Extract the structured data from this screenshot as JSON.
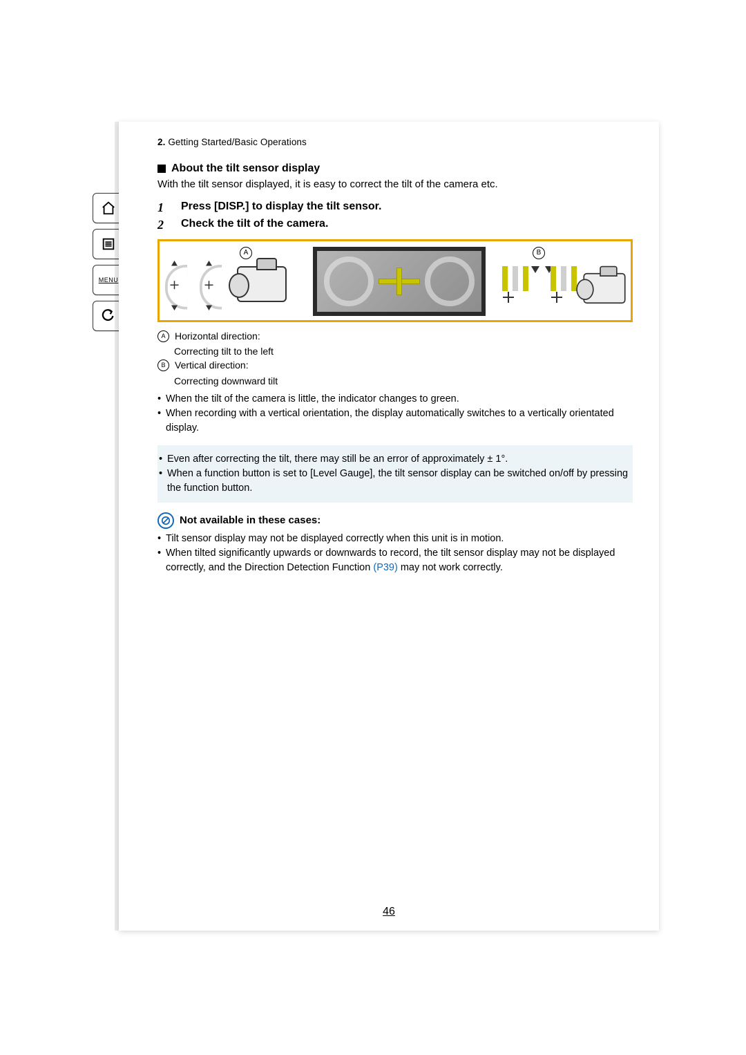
{
  "sidebar": {
    "home": "home-icon",
    "toc": "toc-icon",
    "menu_label": "MENU",
    "back": "back-icon"
  },
  "breadcrumb": {
    "number": "2.",
    "title": "Getting Started/Basic Operations"
  },
  "section": {
    "heading": "About the tilt sensor display",
    "intro": "With the tilt sensor displayed, it is easy to correct the tilt of the camera etc."
  },
  "steps": [
    {
      "n": "1",
      "text": "Press [DISP.] to display the tilt sensor."
    },
    {
      "n": "2",
      "text": "Check the tilt of the camera."
    }
  ],
  "diagram": {
    "label_A": "A",
    "label_B": "B"
  },
  "legend": {
    "A_label": "A",
    "A_title": "Horizontal direction:",
    "A_detail": "Correcting tilt to the left",
    "B_label": "B",
    "B_title": "Vertical direction:",
    "B_detail": "Correcting downward tilt"
  },
  "bullets_main": [
    "When the tilt of the camera is little, the indicator changes to green.",
    "When recording with a vertical orientation, the display automatically switches to a vertically orientated display."
  ],
  "note_bullets": [
    "Even after correcting the tilt, there may still be an error of approximately ± 1°.",
    "When a function button is set to [Level Gauge], the tilt sensor display can be switched on/off by pressing the function button."
  ],
  "not_available": {
    "heading": "Not available in these cases:",
    "bullets_before_ref": "Tilt sensor display may not be displayed correctly when this unit is in motion.",
    "bullet2_a": "When tilted significantly upwards or downwards to record, the tilt sensor display may not be displayed correctly, and the Direction Detection Function ",
    "bullet2_ref": "(P39)",
    "bullet2_b": " may not work correctly."
  },
  "page_number": "46"
}
